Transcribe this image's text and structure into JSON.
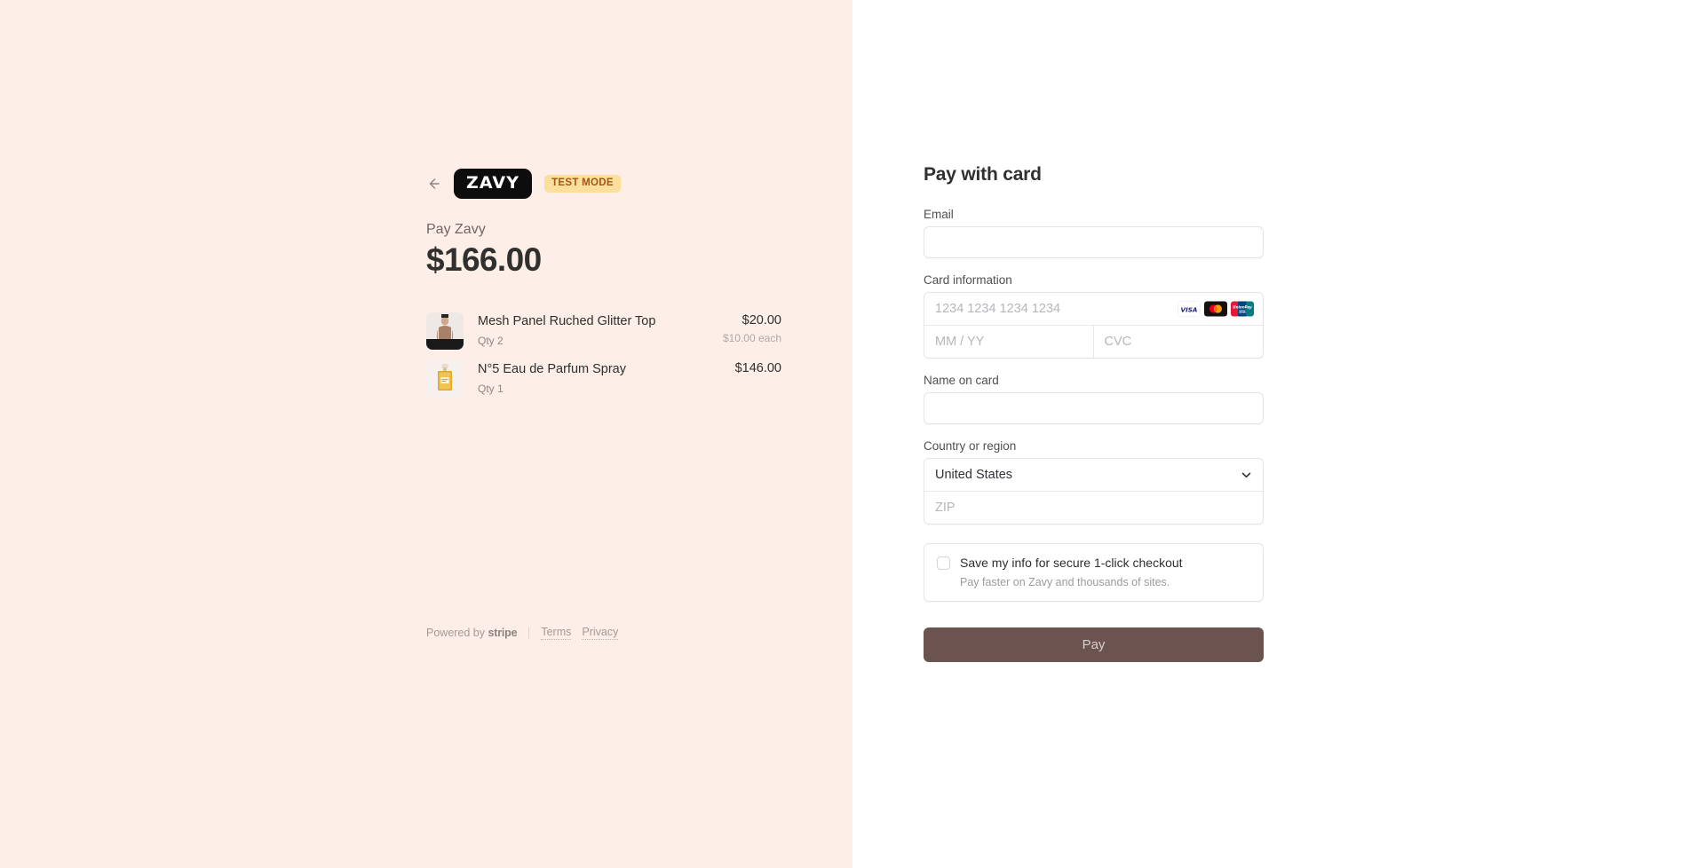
{
  "summary": {
    "back_icon": "arrow-left-icon",
    "merchant_logo_text": "ZAVY",
    "test_mode_badge": "TEST MODE",
    "pay_label": "Pay Zavy",
    "amount": "$166.00",
    "items": [
      {
        "name": "Mesh Panel Ruched Glitter Top",
        "qty": "Qty 2",
        "price": "$20.00",
        "unit": "$10.00 each",
        "thumb": "apparel-photo"
      },
      {
        "name": "N°5 Eau de Parfum Spray",
        "qty": "Qty 1",
        "price": "$146.00",
        "unit": "",
        "thumb": "perfume-photo"
      }
    ],
    "footer": {
      "powered_by": "Powered by ",
      "stripe": "stripe",
      "terms": "Terms",
      "privacy": "Privacy"
    }
  },
  "form": {
    "title": "Pay with card",
    "email_label": "Email",
    "email_value": "",
    "email_placeholder": "",
    "card_label": "Card information",
    "card_number_placeholder": "1234 1234 1234 1234",
    "card_number_value": "",
    "expiry_placeholder": "MM / YY",
    "expiry_value": "",
    "cvc_placeholder": "CVC",
    "cvc_value": "",
    "card_brands": [
      "visa-icon",
      "mastercard-icon",
      "unionpay-icon"
    ],
    "name_label": "Name on card",
    "name_value": "",
    "name_placeholder": "",
    "country_label": "Country or region",
    "country_value": "United States",
    "zip_placeholder": "ZIP",
    "zip_value": "",
    "save_title": "Save my info for secure 1-click checkout",
    "save_subtitle": "Pay faster on Zavy and thousands of sites.",
    "save_checked": false,
    "pay_button": "Pay"
  },
  "colors": {
    "left_background": "#fdeee7",
    "badge_background": "#fcdf9a",
    "badge_text": "#a4551a",
    "pay_button": "#6b5450",
    "logo_background": "#0d0d0d"
  }
}
